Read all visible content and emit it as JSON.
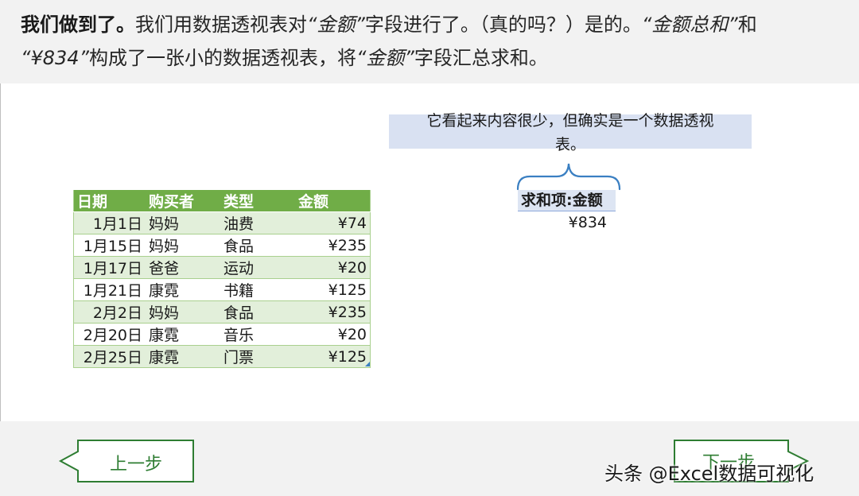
{
  "header": {
    "bold_lead": "我们做到了。",
    "line1_part1": "我们用数据透视表对",
    "quote_field1": "“金额”",
    "line1_part2": "字段进行了。（真的吗？）是的。",
    "quote_sum_label": "“金额总和”",
    "line1_and": "和",
    "quote_total": "“¥834”",
    "line2_part1": "构成了一张小的数据透视表，将",
    "quote_field2": "“金额”",
    "line2_part2": "字段汇总求和。"
  },
  "table": {
    "headers": [
      "日期",
      "购买者",
      "类型",
      "金额"
    ],
    "rows": [
      [
        "1月1日",
        "妈妈",
        "油费",
        "¥74"
      ],
      [
        "1月15日",
        "妈妈",
        "食品",
        "¥235"
      ],
      [
        "1月17日",
        "爸爸",
        "运动",
        "¥20"
      ],
      [
        "1月21日",
        "康霓",
        "书籍",
        "¥125"
      ],
      [
        "2月2日",
        "妈妈",
        "食品",
        "¥235"
      ],
      [
        "2月20日",
        "康霓",
        "音乐",
        "¥20"
      ],
      [
        "2月25日",
        "康霓",
        "门票",
        "¥125"
      ]
    ]
  },
  "callout": {
    "line1": "它看起来内容很少，但确实是一个数据透视",
    "line2": "表。"
  },
  "pivot": {
    "header": "求和项:金额",
    "value": "¥834"
  },
  "nav": {
    "prev_label": "上一步",
    "next_label": "下一步"
  },
  "watermark": "头条 @Excel数据可视化",
  "colors": {
    "table_header": "#70ad47",
    "table_band": "#e2efda",
    "callout_bg": "#d9e1f2",
    "nav_accent": "#2e7d32"
  }
}
